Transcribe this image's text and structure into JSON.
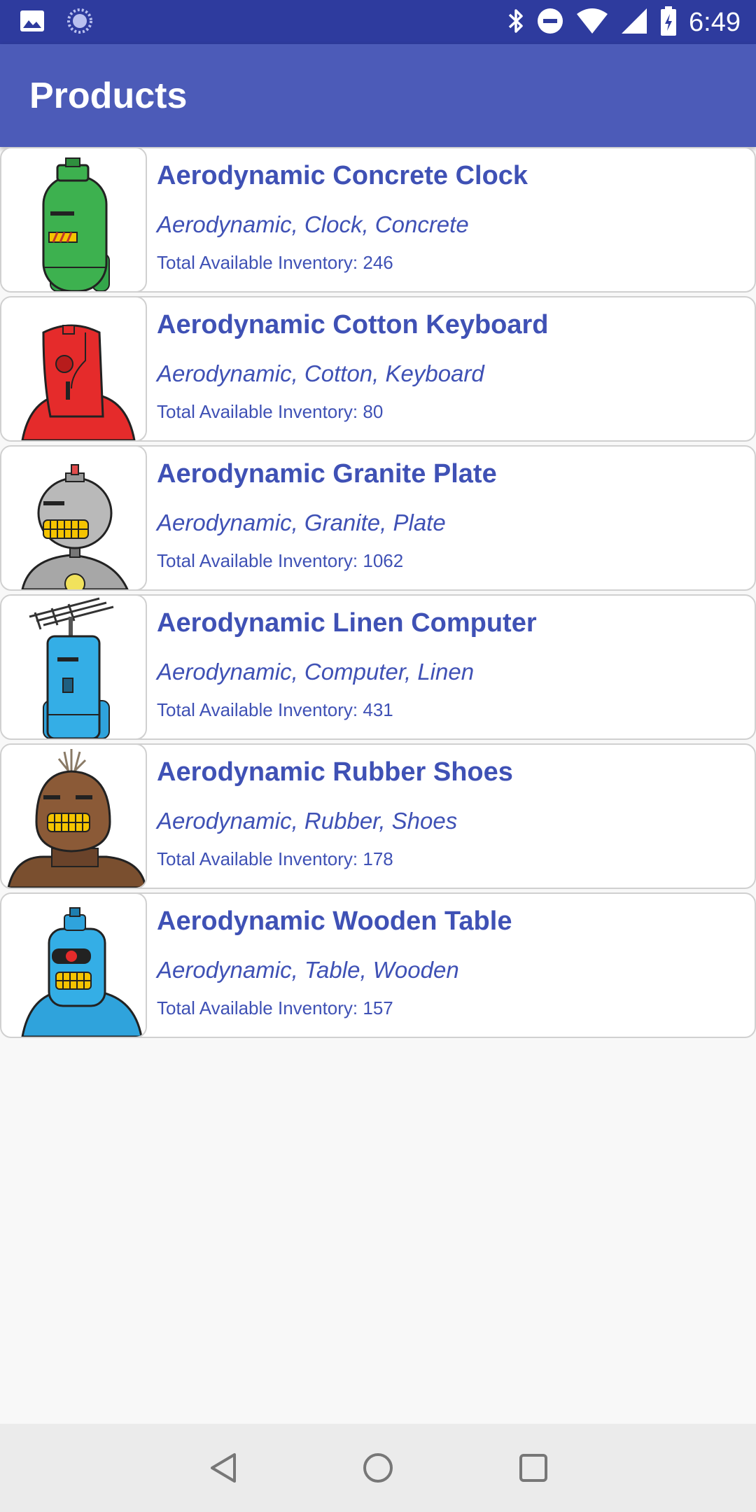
{
  "status_bar": {
    "time": "6:49",
    "left_icons": [
      "image-icon",
      "sync-icon"
    ],
    "right_icons": [
      "bluetooth-icon",
      "do-not-disturb-icon",
      "wifi-icon",
      "signal-icon",
      "battery-charging-icon"
    ]
  },
  "app_bar": {
    "title": "Products"
  },
  "colors": {
    "status_bar": "#2e3b9e",
    "app_bar": "#4c5bb8",
    "text_primary": "#3f51b5",
    "background": "#f8f8f8"
  },
  "products": [
    {
      "name": "Aerodynamic Concrete Clock",
      "tags": "Aerodynamic, Clock, Concrete",
      "inventory": "Total Available Inventory: 246",
      "robot_icon": "green-robot-icon"
    },
    {
      "name": "Aerodynamic Cotton Keyboard",
      "tags": "Aerodynamic, Cotton, Keyboard",
      "inventory": "Total Available Inventory: 80",
      "robot_icon": "red-robot-icon"
    },
    {
      "name": "Aerodynamic Granite Plate",
      "tags": "Aerodynamic, Granite, Plate",
      "inventory": "Total Available Inventory: 1062",
      "robot_icon": "gray-robot-icon"
    },
    {
      "name": "Aerodynamic Linen Computer",
      "tags": "Aerodynamic, Computer, Linen",
      "inventory": "Total Available Inventory: 431",
      "robot_icon": "blue-antenna-robot-icon"
    },
    {
      "name": "Aerodynamic Rubber Shoes",
      "tags": "Aerodynamic, Rubber, Shoes",
      "inventory": "Total Available Inventory: 178",
      "robot_icon": "brown-robot-icon"
    },
    {
      "name": "Aerodynamic Wooden Table",
      "tags": "Aerodynamic, Table, Wooden",
      "inventory": "Total Available Inventory: 157",
      "robot_icon": "blue-robot-icon"
    }
  ],
  "nav_bar": {
    "buttons": [
      "back-icon",
      "home-icon",
      "recents-icon"
    ]
  }
}
